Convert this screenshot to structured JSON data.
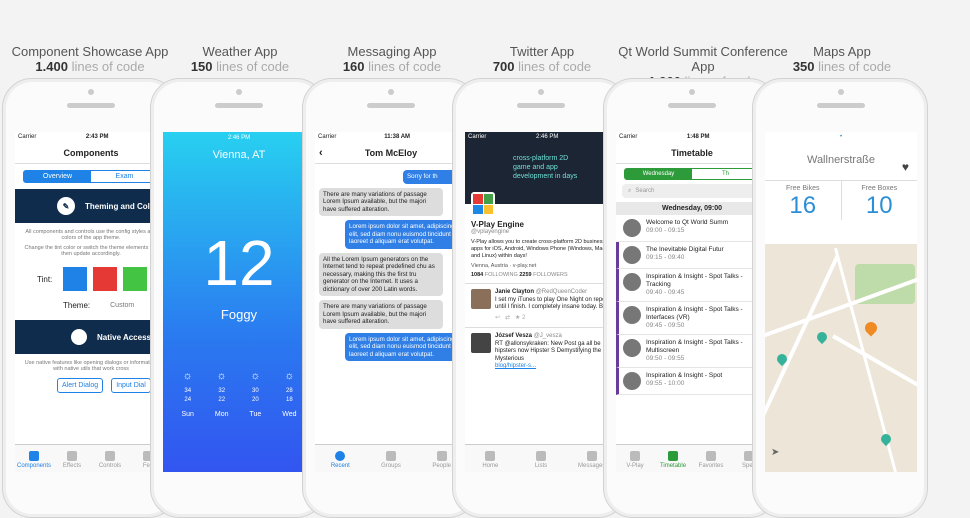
{
  "apps": [
    {
      "name": "Component Showcase App",
      "count": "1.400",
      "lines": "lines of code"
    },
    {
      "name": "Weather App",
      "count": "150",
      "lines": "lines of code"
    },
    {
      "name": "Messaging App",
      "count": "160",
      "lines": "lines of code"
    },
    {
      "name": "Twitter App",
      "count": "700",
      "lines": "lines of code"
    },
    {
      "name": "Qt World Summit Conference App",
      "count": "1.900",
      "lines": "lines of code"
    },
    {
      "name": "Maps App",
      "count": "350",
      "lines": "lines of code"
    }
  ],
  "p1": {
    "carrier": "Carrier",
    "time": "2:43 PM",
    "title": "Components",
    "seg1": "Overview",
    "seg2": "Exam",
    "sec1": "Theming and Colo",
    "t1": "All components and controls use the config styles and colors of the app theme.",
    "t2": "Change the tint color or switch the theme elements will then update accordingly.",
    "tint": "Tint:",
    "theme": "Theme:",
    "custom": "Custom",
    "sec2": "Native Access",
    "t3": "Use native features like opening dialogs or information with native utils that work cross",
    "b1": "Alert Dialog",
    "b2": "Input Dial",
    "tabs": [
      "Components",
      "Effects",
      "Controls",
      "Fea"
    ],
    "colors": {
      "blue": "#1e82e6",
      "red": "#e53935",
      "green": "#43c443",
      "navy": "#0f2c4c"
    }
  },
  "p2": {
    "time": "2:46 PM",
    "city": "Vienna, AT",
    "temp": "12",
    "cond": "Foggy",
    "temps": [
      "34",
      "32",
      "30",
      "28"
    ],
    "temps2": [
      "24",
      "22",
      "20",
      "18"
    ],
    "days": [
      "Sun",
      "Mon",
      "Tue",
      "Wed"
    ]
  },
  "p3": {
    "carrier": "Carrier",
    "time": "11:38 AM",
    "name": "Tom McEloy",
    "m1": "Sorry for th",
    "m2": "There are many variations of passage Lorem Ipsum available, but the majori have suffered alteration.",
    "m3": "Lorem ipsum dolor sit amet, adipiscing elit, sed diam nonu euismod tincidunt ut laoreet d aliquam erat volutpat.",
    "m4": "All the Lorem Ipsum generators on the Internet tend to repeat predefined chu as necessary, making this the first tru generator on the Internet. It uses a dictionary of over 200 Latin words.",
    "m5": "There are many variations of passage Lorem Ipsum available, but the majori have suffered alteration.",
    "m6": "Lorem ipsum dolor sit amet, adipiscing elit, sed diam nonu euismod tincidunt ut laoreet d aliquam erat volutpat.",
    "tabs": [
      "Recent",
      "Groups",
      "People"
    ]
  },
  "p4": {
    "carrier": "Carrier",
    "time": "2:46 PM",
    "banner": "cross-platform 2D game and app development in days",
    "name": "V-Play Engine",
    "handle": "@vplayengine",
    "bio": "V-Play allows you to create cross-platform 2D business apps for iOS, Android, Windows Phone (Windows, Mac and Linux) within days!",
    "loc": "Vienna, Austria",
    "url": "v-play.net",
    "following": "1084",
    "following_l": "FOLLOWING",
    "followers": "2259",
    "followers_l": "FOLLOWERS",
    "u1": "Janie Clayton",
    "h1": "@RedQueenCoder",
    "tw1": "I set my iTunes to play One Night on repeat until I finish. I completely insane today. Blue",
    "n1": "2",
    "u2": "József Vesza",
    "h2": "@J_vesza",
    "tw2": "RT @allonsykraken: New Post ga all be hipsters now Hipster S Demystifying the Mysterious",
    "link": "blog/hipster-s...",
    "tabs": [
      "Home",
      "Lists",
      "Messages"
    ]
  },
  "p5": {
    "carrier": "Carrier",
    "time": "1:48 PM",
    "title": "Timetable",
    "day1": "Wednesday",
    "day2": "Th",
    "search": "Search",
    "header": "Wednesday, 09:00",
    "items": [
      {
        "t": "Welcome to Qt World Summ",
        "tm": "09:00 - 09:15"
      },
      {
        "t": "The Inevitable Digital Futur",
        "tm": "09:15 - 09:40"
      },
      {
        "t": "Inspiration & Insight - Spot Talks - Tracking",
        "tm": "09:40 - 09:45"
      },
      {
        "t": "Inspiration & Insight - Spot Talks - Interfaces (VR)",
        "tm": "09:45 - 09:50"
      },
      {
        "t": "Inspiration & Insight - Spot Talks - Multiscreen",
        "tm": "09:50 - 09:55"
      },
      {
        "t": "Inspiration & Insight - Spot",
        "tm": "09:55 - 10:00"
      }
    ],
    "tabs": [
      "V-Play",
      "Timetable",
      "Favorites",
      "Spea"
    ]
  },
  "p6": {
    "street": "Wallnerstraße",
    "l1": "Free Bikes",
    "l2": "Free Boxes",
    "v1": "16",
    "v2": "10"
  }
}
